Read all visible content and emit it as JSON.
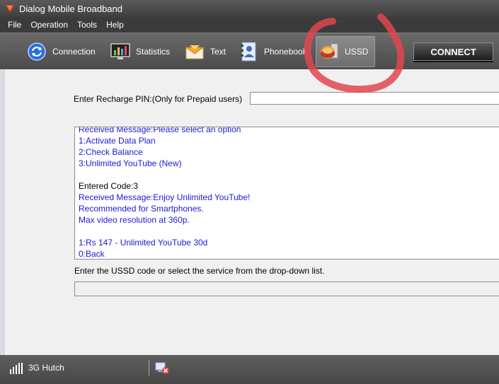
{
  "window": {
    "title": "Dialog Mobile Broadband"
  },
  "menu": {
    "items": [
      "File",
      "Operation",
      "Tools",
      "Help"
    ]
  },
  "toolbar": {
    "items": [
      {
        "label": "Connection",
        "icon": "refresh-icon"
      },
      {
        "label": "Statistics",
        "icon": "chart-monitor-icon"
      },
      {
        "label": "Text",
        "icon": "envelope-icon"
      },
      {
        "label": "Phonebook",
        "icon": "address-book-icon"
      },
      {
        "label": "USSD",
        "icon": "ussd-disc-icon",
        "active": true
      }
    ],
    "connect_label": "CONNECT"
  },
  "recharge": {
    "label": "Enter Recharge PIN:(Only for Prepaid users)",
    "value": ""
  },
  "messages": {
    "lines": [
      {
        "text": "Received Message:Please select an option",
        "color": "blue"
      },
      {
        "text": "1:Activate Data Plan",
        "color": "blue"
      },
      {
        "text": "2:Check Balance",
        "color": "blue"
      },
      {
        "text": "3:Unlimited YouTube (New)",
        "color": "blue"
      },
      {
        "text": "",
        "color": "black"
      },
      {
        "text": "Entered Code:3",
        "color": "black"
      },
      {
        "text": "Received Message:Enjoy Unlimited YouTube!",
        "color": "blue"
      },
      {
        "text": "Recommended for Smartphones.",
        "color": "blue"
      },
      {
        "text": "Max video resolution at 360p.",
        "color": "blue"
      },
      {
        "text": "",
        "color": "blue"
      },
      {
        "text": "1:Rs 147 - Unlimited YouTube 30d",
        "color": "blue"
      },
      {
        "text": "0:Back",
        "color": "blue"
      }
    ]
  },
  "ussd": {
    "label": "Enter the USSD code or select the service from the drop-down list.",
    "value": ""
  },
  "status": {
    "network": "3G  Hutch",
    "icons": [
      "signal-bars-icon",
      "connection-error-icon"
    ]
  },
  "colors": {
    "message_blue": "#1a1ad6",
    "annotation_red": "#e0474d",
    "toolbar_dark": "#4b4b4b"
  }
}
